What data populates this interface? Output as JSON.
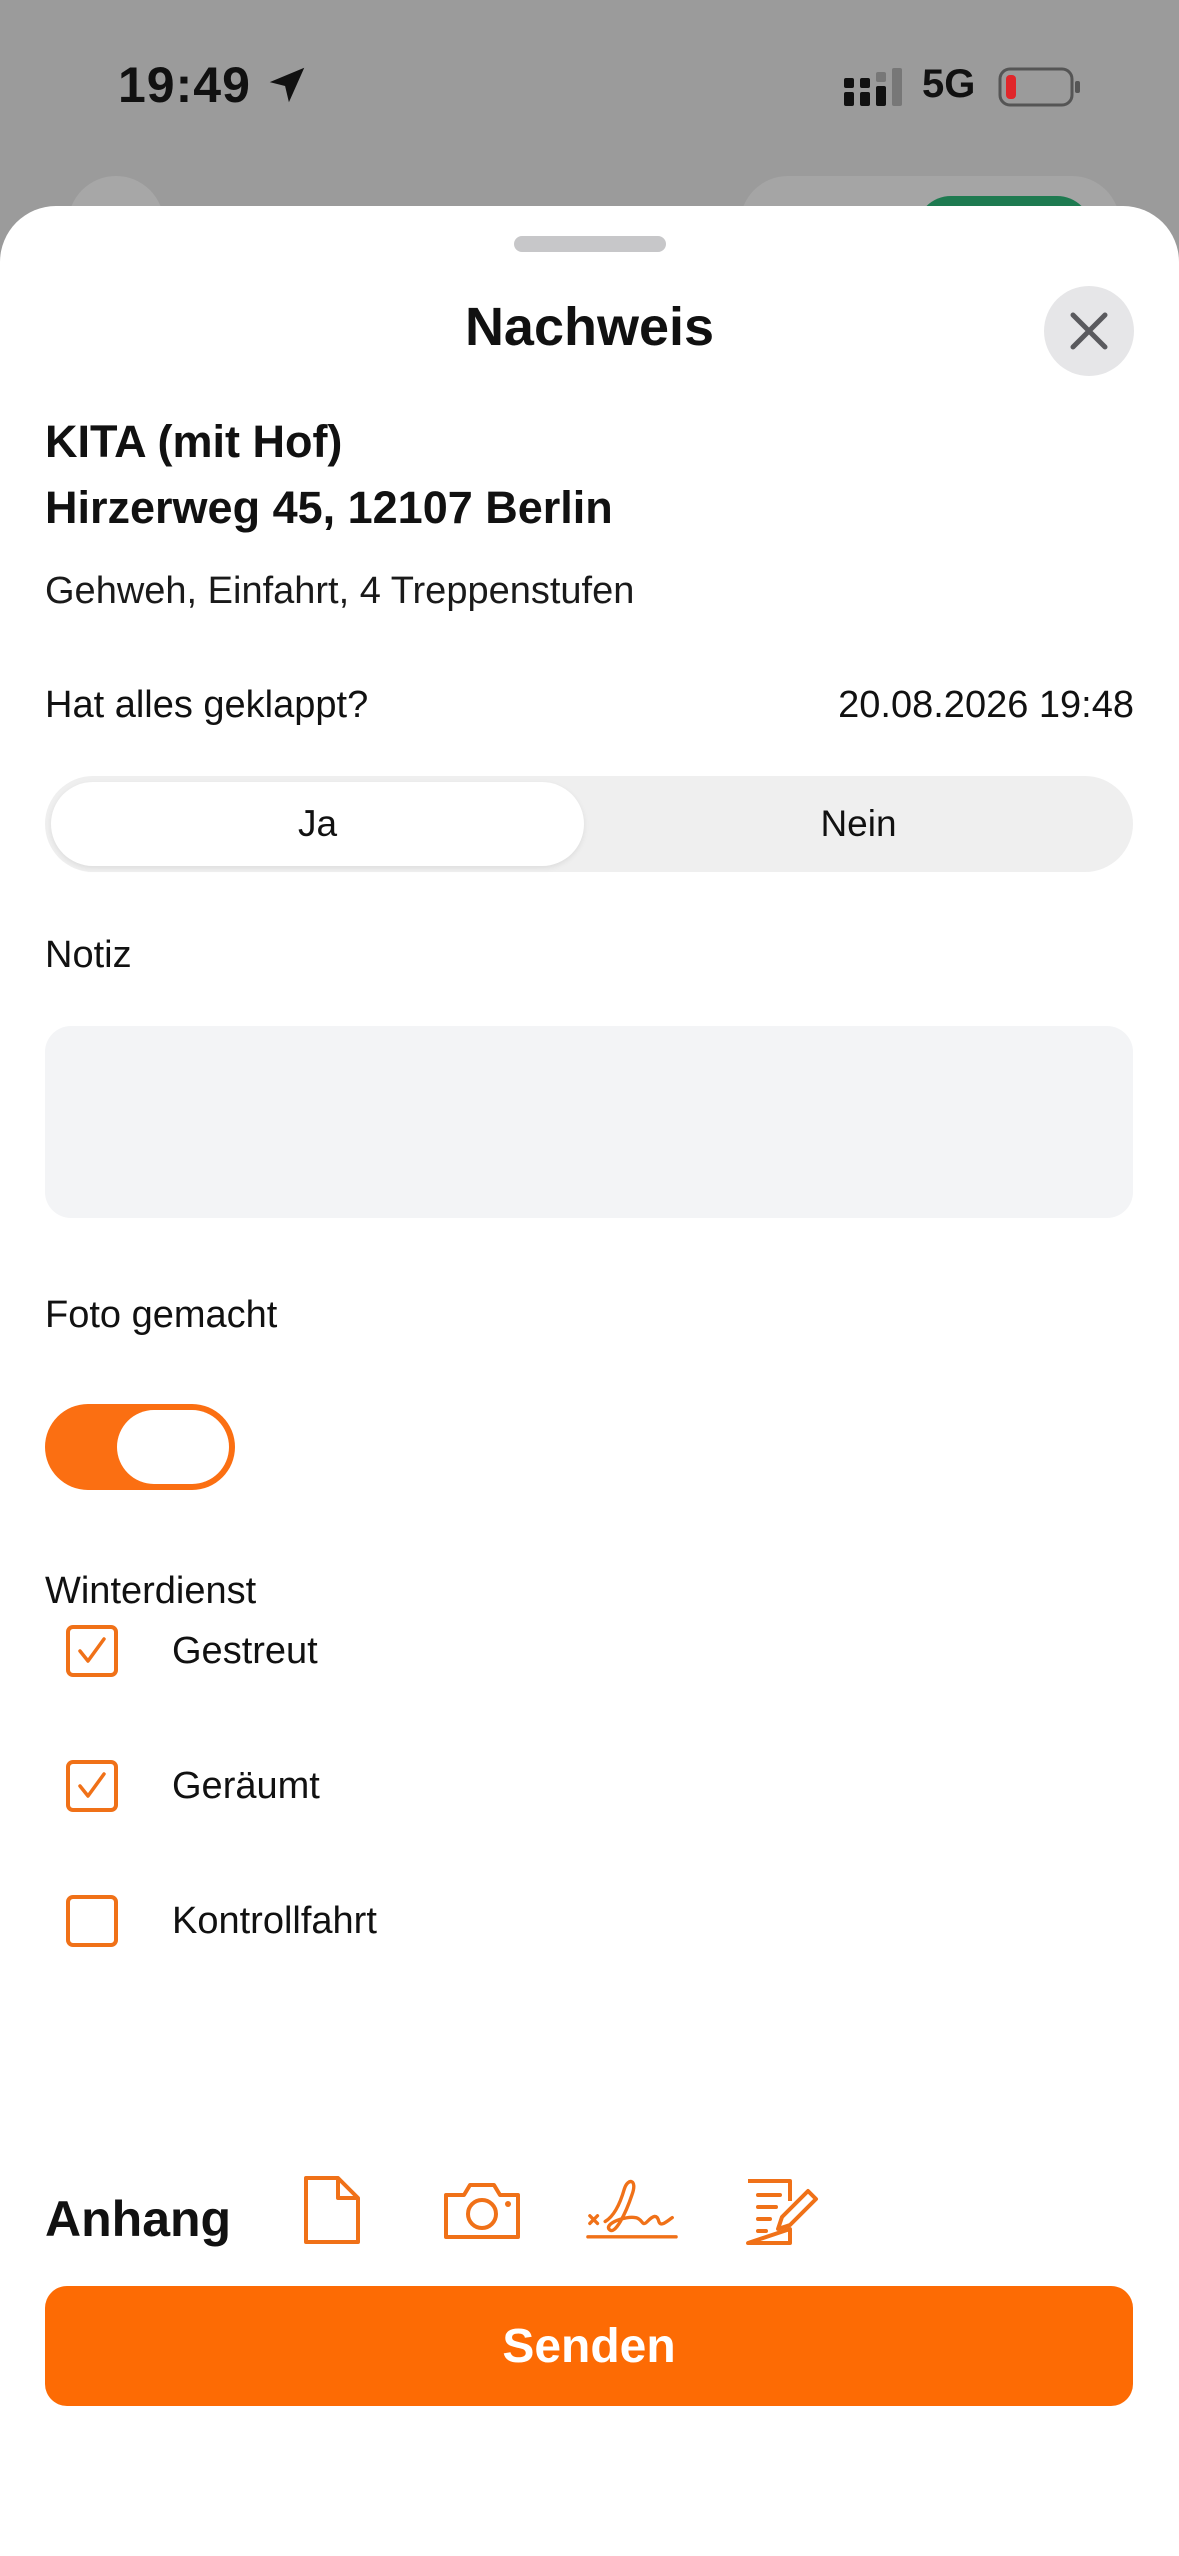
{
  "status_bar": {
    "time": "19:49",
    "network": "5G",
    "icons": [
      "location-arrow-icon",
      "cellular-signal-icon",
      "battery-low-icon"
    ]
  },
  "sheet": {
    "title": "Nachweis",
    "close_icon": "close-icon"
  },
  "location": {
    "name": "KITA (mit Hof)",
    "address": "Hirzerweg 45, 12107 Berlin",
    "details": "Gehweh, Einfahrt, 4 Treppenstufen"
  },
  "status_question": {
    "label": "Hat alles geklappt?",
    "timestamp": "20.08.2026 19:48",
    "options": [
      "Ja",
      "Nein"
    ],
    "selected": "Ja"
  },
  "note": {
    "label": "Notiz",
    "value": "",
    "placeholder": ""
  },
  "photo": {
    "label": "Foto gemacht",
    "enabled": true
  },
  "winterdienst": {
    "label": "Winterdienst",
    "items": [
      {
        "label": "Gestreut",
        "checked": true
      },
      {
        "label": "Geräumt",
        "checked": true
      },
      {
        "label": "Kontrollfahrt",
        "checked": false
      }
    ]
  },
  "attachments": {
    "label": "Anhang",
    "icons": [
      "document-icon",
      "camera-icon",
      "signature-icon",
      "edit-document-icon"
    ]
  },
  "submit": {
    "label": "Senden"
  },
  "colors": {
    "accent": "#FD6B04",
    "checkbox_border": "#F07118",
    "segment_bg": "#EFEFEF",
    "field_bg": "#F3F4F6"
  }
}
